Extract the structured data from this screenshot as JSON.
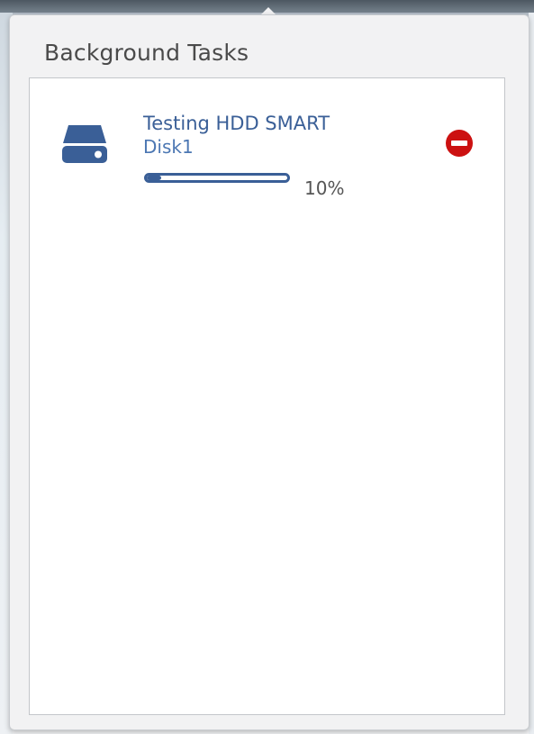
{
  "panel": {
    "title": "Background Tasks"
  },
  "tasks": [
    {
      "title": "Testing HDD SMART",
      "subtitle": "Disk1",
      "progress_percent": 10,
      "progress_label": "10%",
      "icon": "hard-drive-icon",
      "action_icon": "cancel-minus-circle-icon"
    }
  ],
  "colors": {
    "accent": "#3a5f97",
    "subtitle": "#4c77b3",
    "danger": "#cc1111"
  }
}
